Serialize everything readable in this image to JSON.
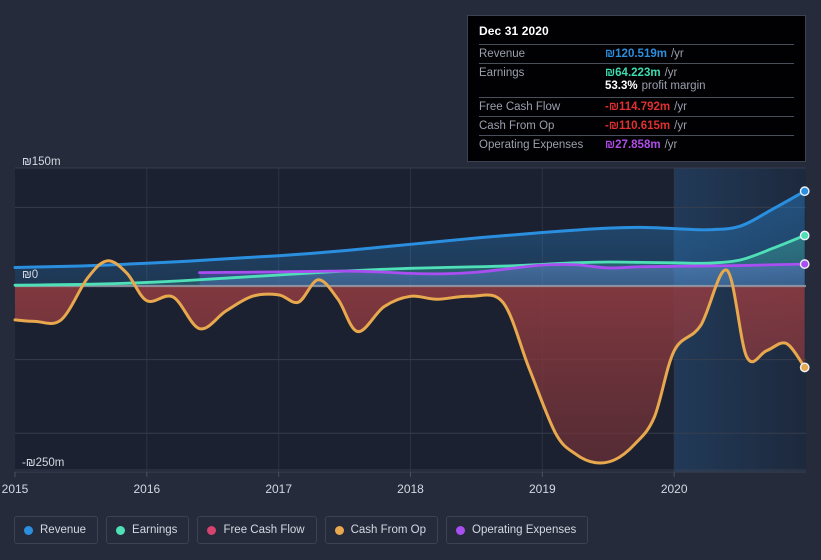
{
  "tooltip": {
    "date": "Dec 31 2020",
    "rows": [
      {
        "label": "Revenue",
        "value": "₪120.519m",
        "unit": "/yr",
        "color": "#2b8fe0"
      },
      {
        "label": "Earnings",
        "value": "₪64.223m",
        "unit": "/yr",
        "color": "#3ddcb0"
      },
      {
        "label": "",
        "value": "53.3%",
        "unit": "profit margin",
        "color": "#ffffff",
        "sub": true
      },
      {
        "label": "Free Cash Flow",
        "value": "-₪114.792m",
        "unit": "/yr",
        "color": "#e03030"
      },
      {
        "label": "Cash From Op",
        "value": "-₪110.615m",
        "unit": "/yr",
        "color": "#e03030"
      },
      {
        "label": "Operating Expenses",
        "value": "₪27.858m",
        "unit": "/yr",
        "color": "#b04de8"
      }
    ]
  },
  "legend": {
    "items": [
      {
        "label": "Revenue",
        "color": "#2b8fe0",
        "icon": "legend-dot-icon"
      },
      {
        "label": "Earnings",
        "color": "#4fe0b8",
        "icon": "legend-dot-icon"
      },
      {
        "label": "Free Cash Flow",
        "color": "#d6436e",
        "icon": "legend-dot-icon"
      },
      {
        "label": "Cash From Op",
        "color": "#e8a84e",
        "icon": "legend-dot-icon"
      },
      {
        "label": "Operating Expenses",
        "color": "#a94ef0",
        "icon": "legend-dot-icon"
      }
    ]
  },
  "chart_data": {
    "type": "line",
    "title": "",
    "xlabel": "",
    "ylabel": "",
    "currency": "₪",
    "units": "m",
    "grid": true,
    "legend_position": "bottom",
    "xlim": [
      2015.0,
      2021.0
    ],
    "ylim": [
      -280,
      160
    ],
    "ytick_labels": [
      "₪150m",
      "₪0",
      "-₪250m"
    ],
    "yticks": [
      150,
      0,
      -250
    ],
    "gridlines_y": [
      150,
      100,
      0,
      -100,
      -200,
      -250
    ],
    "xtick_labels": [
      "2015",
      "2016",
      "2017",
      "2018",
      "2019",
      "2020"
    ],
    "xticks": [
      2015,
      2016,
      2017,
      2018,
      2019,
      2020
    ],
    "zero_line": 0,
    "highlight_region": [
      2020.0,
      2021.0
    ],
    "series": [
      {
        "name": "Revenue",
        "color": "#2b8fe0",
        "fill": "rgba(43,143,224,0.22)",
        "endpoint": 120.519,
        "x": [
          2015.0,
          2015.25,
          2015.5,
          2015.75,
          2016.0,
          2016.25,
          2016.5,
          2016.75,
          2017.0,
          2017.25,
          2017.5,
          2017.75,
          2018.0,
          2018.25,
          2018.5,
          2018.75,
          2019.0,
          2019.25,
          2019.5,
          2019.75,
          2020.0,
          2020.25,
          2020.5,
          2020.75,
          2020.99
        ],
        "values": [
          23.5,
          24.5,
          25.5,
          27.0,
          29.0,
          31.0,
          33.5,
          36.0,
          38.5,
          41.5,
          45.0,
          49.0,
          53.0,
          57.0,
          61.0,
          64.5,
          68.0,
          71.0,
          73.5,
          74.5,
          73.0,
          71.5,
          76.0,
          98.0,
          120.519
        ]
      },
      {
        "name": "Earnings",
        "color": "#4fe0b8",
        "fill": "rgba(79,224,184,0.16)",
        "endpoint": 64.223,
        "x": [
          2015.0,
          2015.25,
          2015.5,
          2015.75,
          2016.0,
          2016.25,
          2016.5,
          2016.75,
          2017.0,
          2017.25,
          2017.5,
          2017.75,
          2018.0,
          2018.25,
          2018.5,
          2018.75,
          2019.0,
          2019.25,
          2019.5,
          2019.75,
          2020.0,
          2020.25,
          2020.5,
          2020.75,
          2020.99
        ],
        "values": [
          1.0,
          1.5,
          2.0,
          3.0,
          4.5,
          6.5,
          9.0,
          11.5,
          14.0,
          16.5,
          19.0,
          21.0,
          22.5,
          23.5,
          24.5,
          25.5,
          27.5,
          29.5,
          30.5,
          30.0,
          29.5,
          29.0,
          33.0,
          48.0,
          64.223
        ]
      },
      {
        "name": "Operating Expenses",
        "color": "#a94ef0",
        "fill": "rgba(169,78,240,0.18)",
        "endpoint": 27.858,
        "start_x": 2016.4,
        "x": [
          2016.4,
          2016.75,
          2017.0,
          2017.25,
          2017.5,
          2017.75,
          2018.0,
          2018.25,
          2018.5,
          2018.75,
          2019.0,
          2019.25,
          2019.5,
          2019.75,
          2020.0,
          2020.25,
          2020.5,
          2020.75,
          2020.99
        ],
        "values": [
          17.0,
          17.5,
          18.0,
          18.5,
          19.0,
          18.0,
          16.0,
          15.5,
          17.5,
          22.0,
          26.5,
          27.0,
          23.0,
          24.5,
          25.0,
          25.5,
          26.0,
          27.0,
          27.858
        ]
      },
      {
        "name": "Free Cash Flow",
        "color": "#d6436e",
        "fill": "rgba(180,52,60,0.45)",
        "endpoint": -114.792,
        "note": "tracks Cash From Op closely; drawn as the red negative fill region",
        "x": [
          2015.0,
          2015.25,
          2015.5,
          2015.75,
          2016.0,
          2016.25,
          2016.5,
          2016.75,
          2017.0,
          2017.25,
          2017.5,
          2017.75,
          2018.0,
          2018.25,
          2018.5,
          2018.75,
          2019.0,
          2019.25,
          2019.5,
          2019.75,
          2020.0,
          2020.25,
          2020.5,
          2020.75,
          2020.99
        ],
        "values": [
          -46,
          -48,
          5,
          30,
          -18,
          -14,
          -60,
          -30,
          -12,
          -22,
          -62,
          -22,
          -220,
          -245,
          -232,
          -215,
          -180,
          -90,
          -60,
          25,
          -90,
          -88,
          -80,
          -35,
          -114.792
        ]
      },
      {
        "name": "Cash From Op",
        "color": "#e8a84e",
        "fill": "rgba(232,168,78,0.30)",
        "endpoint": -110.615,
        "x": [
          2015.0,
          2015.15,
          2015.35,
          2015.55,
          2015.7,
          2015.85,
          2016.0,
          2016.2,
          2016.4,
          2016.6,
          2016.8,
          2017.0,
          2017.15,
          2017.3,
          2017.45,
          2017.6,
          2017.8,
          2018.0,
          2018.2,
          2018.45,
          2018.7,
          2018.9,
          2019.1,
          2019.25,
          2019.4,
          2019.55,
          2019.7,
          2019.85,
          2020.0,
          2020.2,
          2020.4,
          2020.55,
          2020.7,
          2020.85,
          2020.99
        ],
        "values": [
          -46,
          -48,
          -46,
          10,
          32,
          16,
          -20,
          -15,
          -58,
          -34,
          -14,
          -12,
          -22,
          8,
          -18,
          -62,
          -28,
          -14,
          -18,
          -14,
          -22,
          -112,
          -200,
          -228,
          -240,
          -236,
          -215,
          -178,
          -88,
          -54,
          20,
          -96,
          -88,
          -78,
          -110.615
        ]
      }
    ]
  }
}
